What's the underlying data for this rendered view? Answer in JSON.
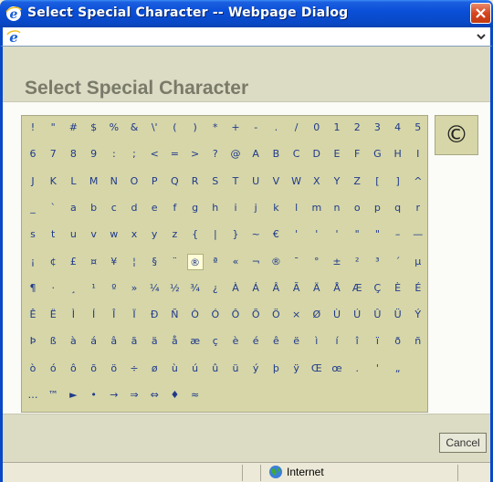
{
  "window": {
    "title": "Select Special Character -- Webpage Dialog"
  },
  "dialog": {
    "heading": "Select Special Character",
    "preview_char": "©",
    "cancel_label": "Cancel"
  },
  "status": {
    "zone": "Internet"
  },
  "colors": {
    "titlebar": "#0a4fd8",
    "grid_bg": "#d6d6a8",
    "char_color": "#1f3a8a",
    "highlight": "#fffcd8"
  },
  "icons": {
    "title": "ie-icon",
    "address": "ie-icon",
    "close": "close-icon",
    "status": "globe-icon"
  },
  "grid": {
    "highlighted": "®",
    "rows": [
      [
        "!",
        "\"",
        "#",
        "$",
        "%",
        "&",
        "\\'",
        "(",
        ")",
        "*",
        "+",
        "-",
        ".",
        "/",
        "0",
        "1",
        "2",
        "3",
        "4",
        "5"
      ],
      [
        "6",
        "7",
        "8",
        "9",
        ":",
        ";",
        "<",
        "=",
        ">",
        "?",
        "@",
        "A",
        "B",
        "C",
        "D",
        "E",
        "F",
        "G",
        "H",
        "I"
      ],
      [
        "J",
        "K",
        "L",
        "M",
        "N",
        "O",
        "P",
        "Q",
        "R",
        "S",
        "T",
        "U",
        "V",
        "W",
        "X",
        "Y",
        "Z",
        "[",
        "]",
        "^"
      ],
      [
        "_",
        "`",
        "a",
        "b",
        "c",
        "d",
        "e",
        "f",
        "g",
        "h",
        "i",
        "j",
        "k",
        "l",
        "m",
        "n",
        "o",
        "p",
        "q",
        "r"
      ],
      [
        "s",
        "t",
        "u",
        "v",
        "w",
        "x",
        "y",
        "z",
        "{",
        "|",
        "}",
        "~",
        "€",
        "'",
        "'",
        "'",
        "\"",
        "\"",
        "–",
        "—"
      ],
      [
        "¡",
        "¢",
        "£",
        "¤",
        "¥",
        "¦",
        "§",
        "¨",
        "®",
        "ª",
        "«",
        "¬",
        "®",
        "¯",
        "°",
        "±",
        "²",
        "³",
        "´",
        "µ"
      ],
      [
        "¶",
        "·",
        "¸",
        "¹",
        "º",
        "»",
        "¼",
        "½",
        "¾",
        "¿",
        "À",
        "Á",
        "Â",
        "Ã",
        "Ä",
        "Å",
        "Æ",
        "Ç",
        "È",
        "É"
      ],
      [
        "Ê",
        "Ë",
        "Ì",
        "Í",
        "Î",
        "Ï",
        "Ð",
        "Ñ",
        "Ò",
        "Ó",
        "Ô",
        "Õ",
        "Ö",
        "×",
        "Ø",
        "Ù",
        "Ú",
        "Û",
        "Ü",
        "Ý"
      ],
      [
        "Þ",
        "ß",
        "à",
        "á",
        "â",
        "ã",
        "ä",
        "å",
        "æ",
        "ç",
        "è",
        "é",
        "ê",
        "ë",
        "ì",
        "í",
        "î",
        "ï",
        "ð",
        "ñ"
      ],
      [
        "ò",
        "ó",
        "ô",
        "õ",
        "ö",
        "÷",
        "ø",
        "ù",
        "ú",
        "û",
        "ü",
        "ý",
        "þ",
        "ÿ",
        "Œ",
        "œ",
        ".",
        "'",
        "„",
        ""
      ],
      [
        "…",
        "™",
        "►",
        "•",
        "→",
        "⇒",
        "⇔",
        "♦",
        "≈",
        "",
        "",
        "",
        "",
        "",
        "",
        "",
        "",
        "",
        "",
        ""
      ]
    ]
  }
}
